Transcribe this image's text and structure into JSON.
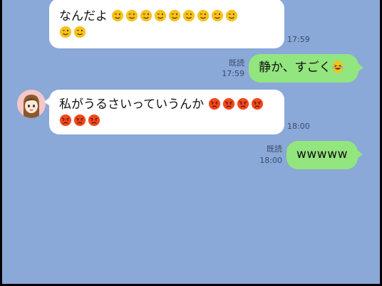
{
  "messages": [
    {
      "id": "m1",
      "side": "left",
      "text": "なんだよ",
      "emoji": "wink",
      "emoji_count_line1": 9,
      "emoji_count_line2": 2,
      "time": "17:59"
    },
    {
      "id": "m2",
      "side": "right",
      "text": "静か、すごく",
      "emoji": "laugh",
      "read_label": "既読",
      "time": "17:59"
    },
    {
      "id": "m3",
      "side": "left",
      "text": "私がうるさいっていうんか",
      "emoji": "angry",
      "emoji_count_line1": 4,
      "emoji_count_line2": 3,
      "time": "18:00"
    },
    {
      "id": "m4",
      "side": "right",
      "text": "wwwww",
      "read_label": "既読",
      "time": "18:00"
    }
  ],
  "colors": {
    "background": "#8aa8d8",
    "left_bubble": "#ffffff",
    "right_bubble": "#93e57f",
    "emoji_yellow": "#f6c21c",
    "emoji_angry": "#f04a1c"
  }
}
